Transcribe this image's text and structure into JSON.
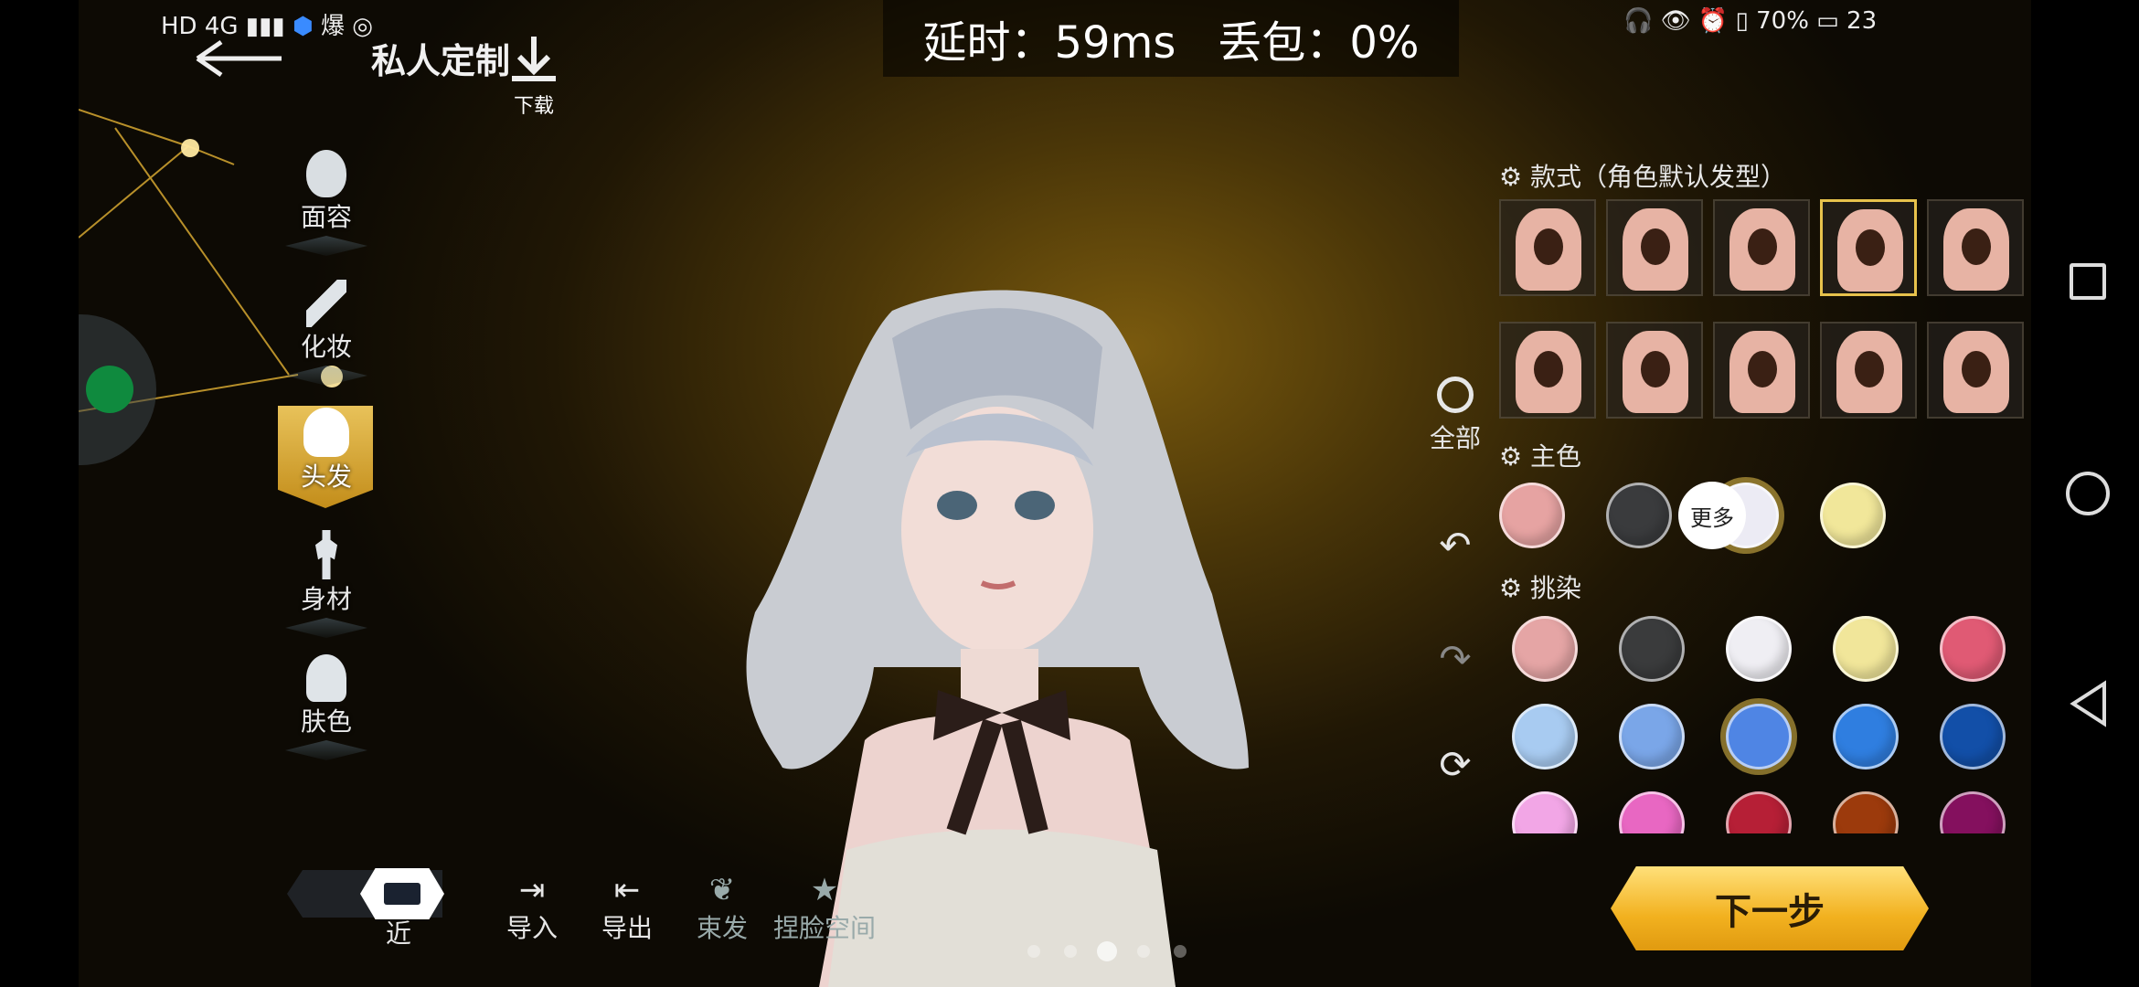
{
  "status_bar": {
    "left": "HD 4G",
    "app_text": "爆",
    "battery": "70%",
    "time": "23"
  },
  "header": {
    "back_label": "私人定制",
    "download_label": "下载"
  },
  "stats": {
    "latency": "延时：59ms",
    "loss": "丢包：0%"
  },
  "sidebar": {
    "items": [
      {
        "label": "面容"
      },
      {
        "label": "化妆"
      },
      {
        "label": "头发"
      },
      {
        "label": "身材"
      },
      {
        "label": "肤色"
      }
    ]
  },
  "panel": {
    "style_title": "款式（角色默认发型）",
    "main_color_title": "主色",
    "dye_title": "挑染",
    "more_label": "更多",
    "main_colors": [
      "#e6a3a2",
      "#3a3b3d",
      "#ecebf4",
      "#f1e79a"
    ],
    "dye_colors": [
      "#e5a5a5",
      "#3a3b3c",
      "#efeef3",
      "#f1e69a",
      "#e05a74",
      "#a8cbf1",
      "#7aa6e8",
      "#4f85e4",
      "#2f7ee0",
      "#124fa8",
      "#f2a6e6",
      "#e867c2",
      "#b61f36",
      "#9c3a0c",
      "#84105e"
    ]
  },
  "side_tools": {
    "all_label": "全部"
  },
  "bottom": {
    "zoom_label": "近",
    "import_label": "导入",
    "export_label": "导出",
    "tie_label": "束发",
    "face_label": "捏脸空间",
    "next_label": "下一步"
  }
}
